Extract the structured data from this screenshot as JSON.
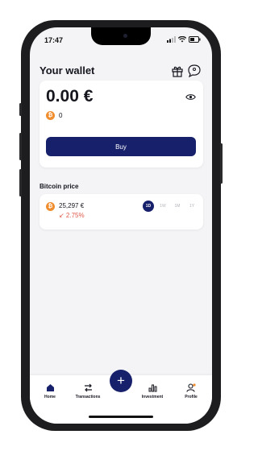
{
  "status_bar": {
    "time": "17:47"
  },
  "header": {
    "title": "Your wallet",
    "gift_icon": "gift-icon",
    "chat_icon": "chat-icon"
  },
  "wallet": {
    "balance": "0.00 €",
    "btc_symbol": "₿",
    "btc_amount": "0",
    "visibility_icon": "eye-icon",
    "buy_label": "Buy"
  },
  "bitcoin_price": {
    "section_title": "Bitcoin price",
    "price": "25,297 €",
    "change": "↙ 2.75%",
    "change_color": "#e0584a",
    "periods": [
      "1D",
      "1W",
      "1M",
      "1Y"
    ],
    "selected_period": "1D"
  },
  "nav": {
    "items": [
      {
        "label": "Home",
        "icon": "home-icon"
      },
      {
        "label": "Transactions",
        "icon": "transactions-icon"
      },
      {
        "label": "Investment",
        "icon": "investment-icon"
      },
      {
        "label": "Profile",
        "icon": "profile-icon"
      }
    ],
    "fab_label": "+"
  },
  "colors": {
    "primary": "#17206a",
    "bitcoin": "#f08d2e",
    "negative": "#e0584a",
    "background": "#f4f4f6"
  }
}
